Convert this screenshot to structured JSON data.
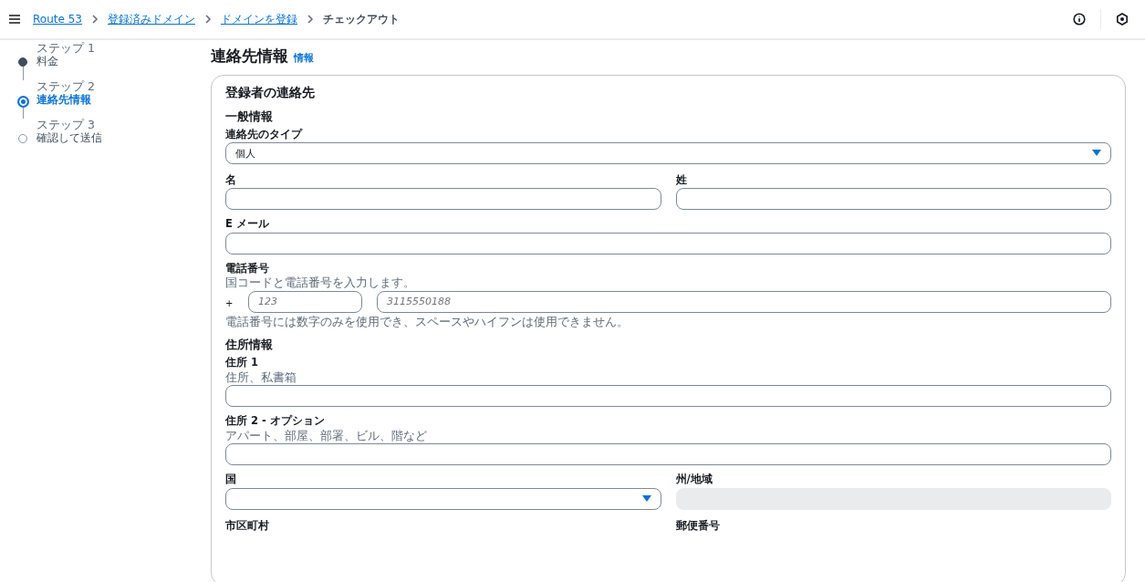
{
  "breadcrumbs": [
    {
      "label": "Route 53",
      "link": true
    },
    {
      "label": "登録済みドメイン",
      "link": true
    },
    {
      "label": "ドメインを登録",
      "link": true
    },
    {
      "label": "チェックアウト",
      "link": false
    }
  ],
  "steps": [
    {
      "caption": "ステップ 1",
      "label": "料金",
      "selected": false,
      "completed": true
    },
    {
      "caption": "ステップ 2",
      "label": "連絡先情報",
      "selected": true,
      "completed": false
    },
    {
      "caption": "ステップ 3",
      "label": "確認して送信",
      "selected": false,
      "completed": false
    }
  ],
  "page_title": "連絡先情報",
  "info_link": "情報",
  "card": {
    "title": "登録者の連絡先",
    "general": {
      "heading": "一般情報",
      "contact_type": {
        "label": "連絡先のタイプ",
        "value": "個人"
      },
      "first_name": {
        "label": "名"
      },
      "last_name": {
        "label": "姓"
      },
      "email": {
        "label": "E メール"
      },
      "phone": {
        "label": "電話番号",
        "description": "国コードと電話番号を入力します。",
        "prefix": "+",
        "code_placeholder": "123",
        "number_placeholder": "3115550188",
        "constraint": "電話番号には数字のみを使用でき、スペースやハイフンは使用できません。"
      }
    },
    "address": {
      "heading": "住所情報",
      "address1": {
        "label": "住所 1",
        "description": "住所、私書箱"
      },
      "address2": {
        "label": "住所 2 - オプション",
        "description": "アパート、部屋、部署、ビル、階など"
      },
      "country": {
        "label": "国"
      },
      "state": {
        "label": "州/地域",
        "disabled": true
      },
      "city": {
        "label": "市区町村"
      },
      "postal": {
        "label": "郵便番号"
      }
    }
  }
}
